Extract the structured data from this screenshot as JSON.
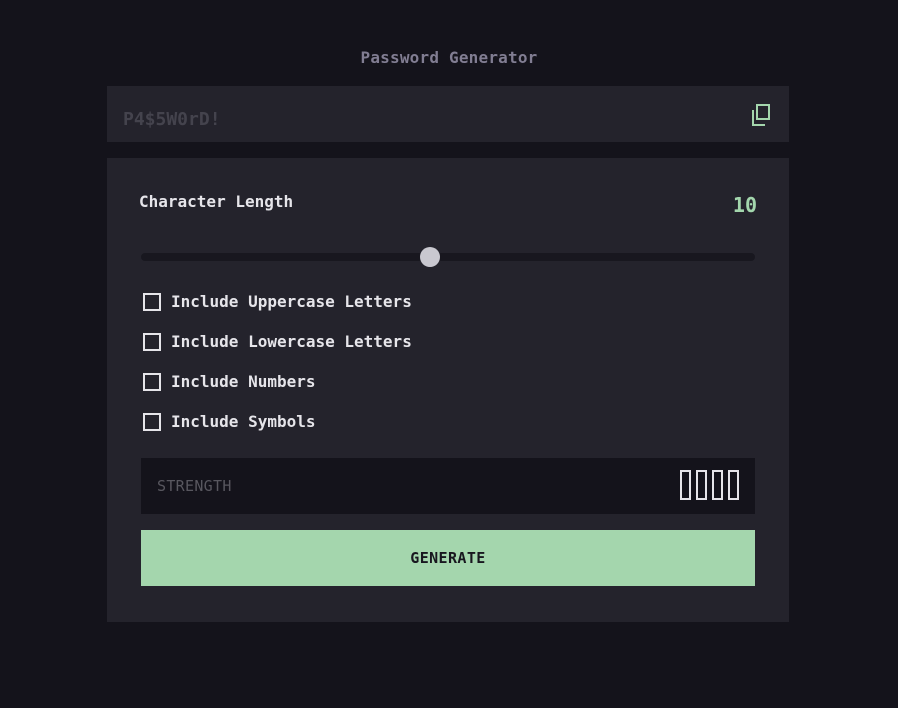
{
  "app": {
    "title": "Password Generator"
  },
  "output": {
    "password_placeholder": "P4$5W0rD!",
    "copy_icon": "copy-icon"
  },
  "length": {
    "label": "Character Length",
    "value": "10",
    "slider_fraction": 0.47
  },
  "options": [
    {
      "label": "Include Uppercase Letters",
      "checked": false
    },
    {
      "label": "Include Lowercase Letters",
      "checked": false
    },
    {
      "label": "Include Numbers",
      "checked": false
    },
    {
      "label": "Include Symbols",
      "checked": false
    }
  ],
  "strength": {
    "label": "STRENGTH",
    "level": 0,
    "max_level": 4
  },
  "actions": {
    "generate_label": "GENERATE"
  },
  "colors": {
    "background": "#14131b",
    "panel": "#24232c",
    "accent": "#a4d6ad",
    "text": "#e6e5ea",
    "muted": "#817d92"
  }
}
